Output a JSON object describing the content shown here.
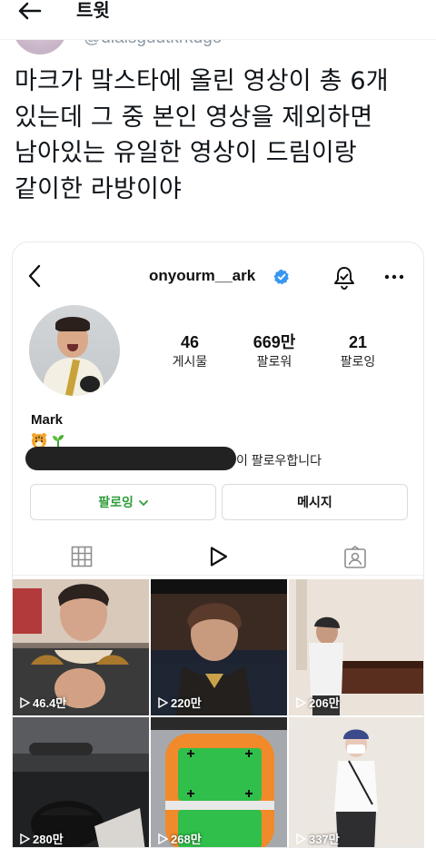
{
  "header": {
    "title": "트윗"
  },
  "author": {
    "handle": "@dlalsgudtkrkdgo"
  },
  "tweet": {
    "lines": [
      "마크가 맠스타에 올린 영상이 총 6개",
      "있는데 그 중 본인 영상을 제외하면",
      "남아있는 유일한 영상이 드림이랑",
      "같이한 라방이야"
    ]
  },
  "instagram": {
    "username": "onyourm__ark",
    "stats": [
      {
        "value": "46",
        "label": "게시물"
      },
      {
        "value": "669만",
        "label": "팔로워"
      },
      {
        "value": "21",
        "label": "팔로잉"
      }
    ],
    "bio_name": "Mark",
    "bio_emoji": "🐯🌱",
    "followed_by_text": "이 팔로우합니다",
    "follow_button": "팔로잉",
    "message_button": "메시지",
    "reels": [
      {
        "views": "46.4만"
      },
      {
        "views": "220만"
      },
      {
        "views": "206만"
      },
      {
        "views": "280만"
      },
      {
        "views": "268만"
      },
      {
        "views": "337만"
      }
    ]
  },
  "colors": {
    "verified": "#3897f0",
    "following_green": "#2f9e3a"
  }
}
